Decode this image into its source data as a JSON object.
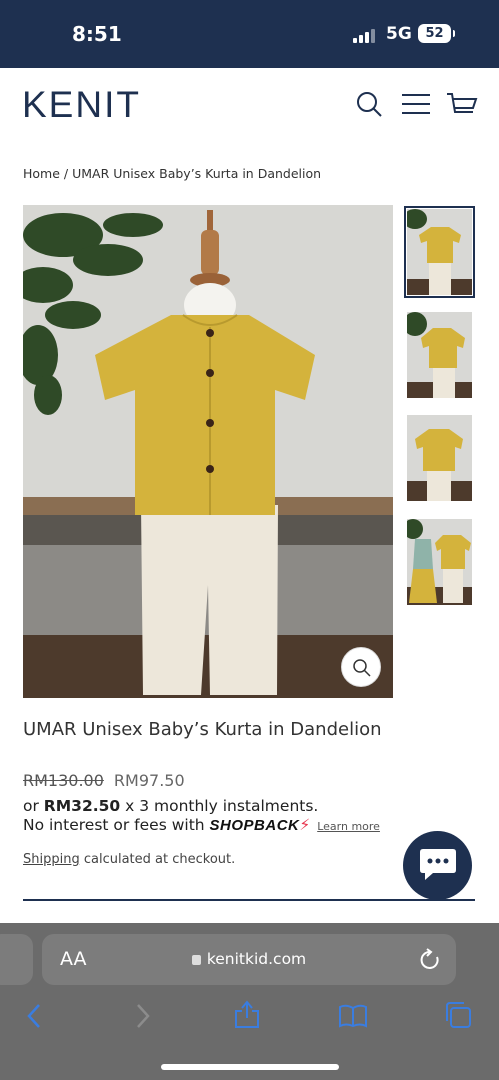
{
  "status": {
    "time": "8:51",
    "network": "5G",
    "battery": "52"
  },
  "header": {
    "logo": "KENIT"
  },
  "breadcrumb": {
    "home": "Home",
    "separator": " / ",
    "current": "UMAR Unisex Baby’s Kurta in Dandelion"
  },
  "product": {
    "title": "UMAR Unisex Baby’s Kurta in Dandelion",
    "price_old": "RM130.00",
    "price_new": "RM97.50",
    "instalment_prefix": "or ",
    "instalment_amount": "RM32.50",
    "instalment_suffix": " x 3 monthly instalments.",
    "no_interest": "No interest or fees with ",
    "shopback": "SHOPBACK",
    "learn_more": "Learn more",
    "shipping_link": "Shipping",
    "shipping_text": " calculated at checkout."
  },
  "browser": {
    "text_size": "AA",
    "url": "kenitkid.com"
  },
  "icons": [
    "search-icon",
    "menu-icon",
    "cart-icon",
    "zoom-icon",
    "chat-icon",
    "lock-icon",
    "reload-icon",
    "back-icon",
    "forward-icon",
    "share-icon",
    "bookmarks-icon",
    "tabs-icon"
  ],
  "colors": {
    "brand": "#1e3050",
    "shirt": "#d4b33c",
    "pants": "#ede7da"
  }
}
